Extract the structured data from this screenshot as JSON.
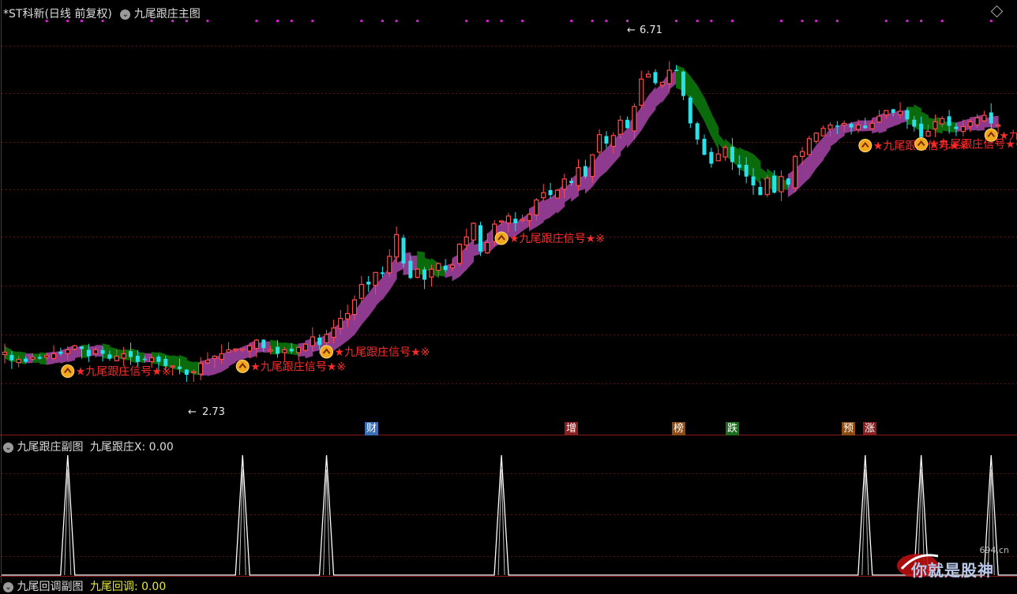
{
  "main_panel": {
    "title": "*ST科新(日线 前复权)",
    "indicator": "九尾跟庄主图",
    "high_label": "6.71",
    "low_label": "2.73",
    "signal_text": "★九尾跟庄信号★※",
    "notes": [
      {
        "text": "财",
        "color": "#3a6fb3"
      },
      {
        "text": "增",
        "color": "#8a1f1f"
      },
      {
        "text": "榜",
        "color": "#8a4a12"
      },
      {
        "text": "跌",
        "color": "#1d6b1d"
      },
      {
        "text": "预",
        "color": "#8a4a12"
      },
      {
        "text": "涨",
        "color": "#8a1f1f"
      }
    ],
    "colors": {
      "up": "#ff4b4b",
      "down": "#29e1e8",
      "band_up": "#8e3a8e",
      "band_down": "#0b6a0b",
      "signal": "#ff2a2a",
      "dots": "#d21fd2"
    }
  },
  "sub_panel": {
    "title": "九尾跟庄副图",
    "value_label": "九尾跟庄X: 0.00"
  },
  "bottom_panel": {
    "title": "九尾回调副图",
    "value_label": "九尾回调: 0.00"
  },
  "watermark": {
    "site": "694.cn",
    "text": "你就是股神"
  },
  "chart_data": {
    "type": "candlestick",
    "ylim": [
      2.3,
      7.0
    ],
    "high": {
      "value": 6.71
    },
    "low": {
      "value": 2.73
    },
    "closes": [
      3.02,
      2.92,
      2.93,
      2.9,
      2.96,
      2.94,
      2.98,
      3.0,
      3.0,
      3.05,
      3.1,
      3.06,
      2.97,
      3.05,
      3.0,
      2.94,
      2.97,
      3.0,
      2.96,
      2.9,
      2.93,
      2.95,
      2.9,
      2.85,
      2.85,
      2.81,
      2.74,
      2.78,
      2.88,
      2.92,
      2.97,
      3.0,
      3.05,
      3.06,
      3.06,
      3.1,
      3.17,
      3.07,
      3.05,
      3.0,
      3.05,
      3.03,
      3.08,
      3.12,
      3.21,
      3.11,
      3.24,
      3.32,
      3.44,
      3.5,
      3.67,
      3.86,
      3.86,
      4.01,
      3.99,
      4.21,
      4.48,
      4.12,
      3.94,
      4.05,
      3.92,
      4.05,
      4.12,
      4.04,
      4.1,
      4.36,
      4.45,
      4.62,
      4.27,
      4.38,
      4.61,
      4.65,
      4.71,
      4.62,
      4.67,
      4.73,
      4.91,
      5.0,
      4.97,
      5.03,
      5.17,
      5.12,
      5.31,
      5.2,
      5.47,
      5.72,
      5.61,
      5.71,
      5.9,
      5.8,
      6.07,
      6.41,
      6.47,
      6.36,
      6.37,
      6.52,
      6.51,
      6.2,
      5.86,
      5.66,
      5.47,
      5.36,
      5.48,
      5.56,
      5.38,
      5.31,
      5.2,
      5.09,
      4.97,
      5.18,
      5.0,
      5.2,
      5.1,
      5.45,
      5.51,
      5.67,
      5.74,
      5.8,
      5.84,
      5.83,
      5.86,
      5.81,
      5.84,
      5.8,
      5.86,
      5.95,
      6.02,
      5.99,
      6.01,
      5.91,
      5.82,
      5.69,
      5.76,
      5.88,
      5.92,
      5.83,
      5.79,
      5.82,
      5.88,
      5.93,
      5.96,
      5.86,
      5.84
    ],
    "signals": [
      {
        "x": 9,
        "value": 3.0
      },
      {
        "x": 34,
        "value": 3.06
      },
      {
        "x": 46,
        "value": 3.24
      },
      {
        "x": 71,
        "value": 4.65
      },
      {
        "x": 123,
        "value": 5.8
      },
      {
        "x": 131,
        "value": 5.82
      },
      {
        "x": 141,
        "value": 5.93
      }
    ]
  }
}
